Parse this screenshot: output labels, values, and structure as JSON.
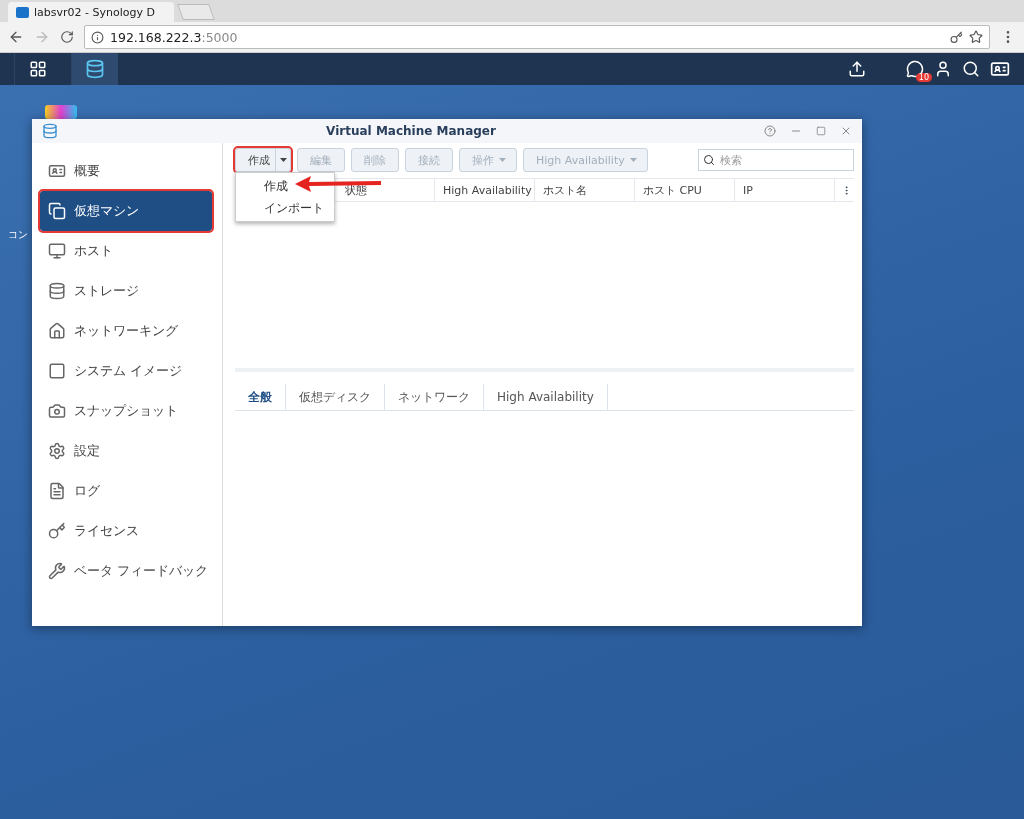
{
  "browser": {
    "tab_title": "labsvr02 - Synology D",
    "url_host": "192.168.222.3",
    "url_port": ":5000"
  },
  "taskbar": {
    "notification_count": "10"
  },
  "desktop": {
    "icon_label": "コン"
  },
  "window": {
    "title": "Virtual Machine Manager",
    "sidebar": {
      "items": [
        {
          "label": "概要",
          "selected": false,
          "highlighted": false
        },
        {
          "label": "仮想マシン",
          "selected": true,
          "highlighted": true
        },
        {
          "label": "ホスト",
          "selected": false,
          "highlighted": false
        },
        {
          "label": "ストレージ",
          "selected": false,
          "highlighted": false
        },
        {
          "label": "ネットワーキング",
          "selected": false,
          "highlighted": false
        },
        {
          "label": "システム イメージ",
          "selected": false,
          "highlighted": false
        },
        {
          "label": "スナップショット",
          "selected": false,
          "highlighted": false
        },
        {
          "label": "設定",
          "selected": false,
          "highlighted": false
        },
        {
          "label": "ログ",
          "selected": false,
          "highlighted": false
        },
        {
          "label": "ライセンス",
          "selected": false,
          "highlighted": false
        },
        {
          "label": "ベータ フィードバック",
          "selected": false,
          "highlighted": false
        }
      ]
    },
    "toolbar": {
      "buttons": [
        {
          "label": "作成",
          "kind": "split",
          "disabled": false,
          "highlighted": true
        },
        {
          "label": "編集",
          "kind": "plain",
          "disabled": true,
          "highlighted": false
        },
        {
          "label": "削除",
          "kind": "plain",
          "disabled": true,
          "highlighted": false
        },
        {
          "label": "接続",
          "kind": "plain",
          "disabled": true,
          "highlighted": false
        },
        {
          "label": "操作",
          "kind": "dropdown",
          "disabled": true,
          "highlighted": false
        },
        {
          "label": "High Availability",
          "kind": "dropdown",
          "disabled": true,
          "highlighted": false
        }
      ],
      "search": {
        "placeholder": "検索"
      }
    },
    "menu": {
      "items": [
        {
          "label": "作成"
        },
        {
          "label": "インポート"
        }
      ]
    },
    "table": {
      "columns": [
        "状態",
        "High Availability",
        "ホスト名",
        "ホスト CPU",
        "IP"
      ]
    },
    "detail_tabs": [
      {
        "label": "全般",
        "selected": true
      },
      {
        "label": "仮想ディスク",
        "selected": false
      },
      {
        "label": "ネットワーク",
        "selected": false
      },
      {
        "label": "High Availability",
        "selected": false
      }
    ]
  }
}
